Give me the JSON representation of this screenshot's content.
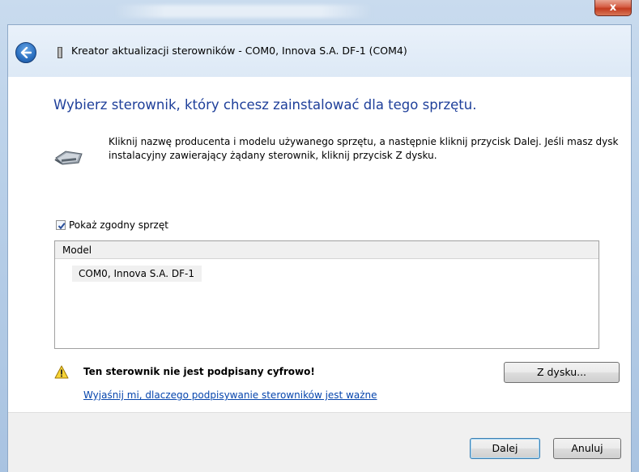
{
  "window": {
    "close_label": "x"
  },
  "wizard": {
    "title": "Kreator aktualizacji sterowników - COM0, Innova S.A. DF-1 (COM4)",
    "heading": "Wybierz sterownik, który chcesz zainstalować dla tego sprzętu.",
    "instruction": "Kliknij nazwę producenta i modelu używanego sprzętu, a następnie kliknij przycisk Dalej. Jeśli masz dysk instalacyjny zawierający żądany sterownik, kliknij przycisk Z dysku."
  },
  "compat": {
    "label": "Pokaż zgodny sprzęt",
    "checked": true
  },
  "list": {
    "header": "Model",
    "items": [
      "COM0, Innova S.A. DF-1"
    ]
  },
  "warning": {
    "text": "Ten sterownik nie jest podpisany cyfrowo!",
    "link": "Wyjaśnij mi, dlaczego podpisywanie sterowników jest ważne"
  },
  "buttons": {
    "have_disk": "Z dysku...",
    "next": "Dalej",
    "cancel": "Anuluj"
  },
  "icons": {
    "back": "back-arrow-icon",
    "device": "serial-cable-icon",
    "warning": "warning-triangle-icon",
    "check": "checkmark-icon"
  },
  "colors": {
    "heading": "#1e3f9a",
    "link": "#0645ad",
    "close": "#c33b1f"
  }
}
